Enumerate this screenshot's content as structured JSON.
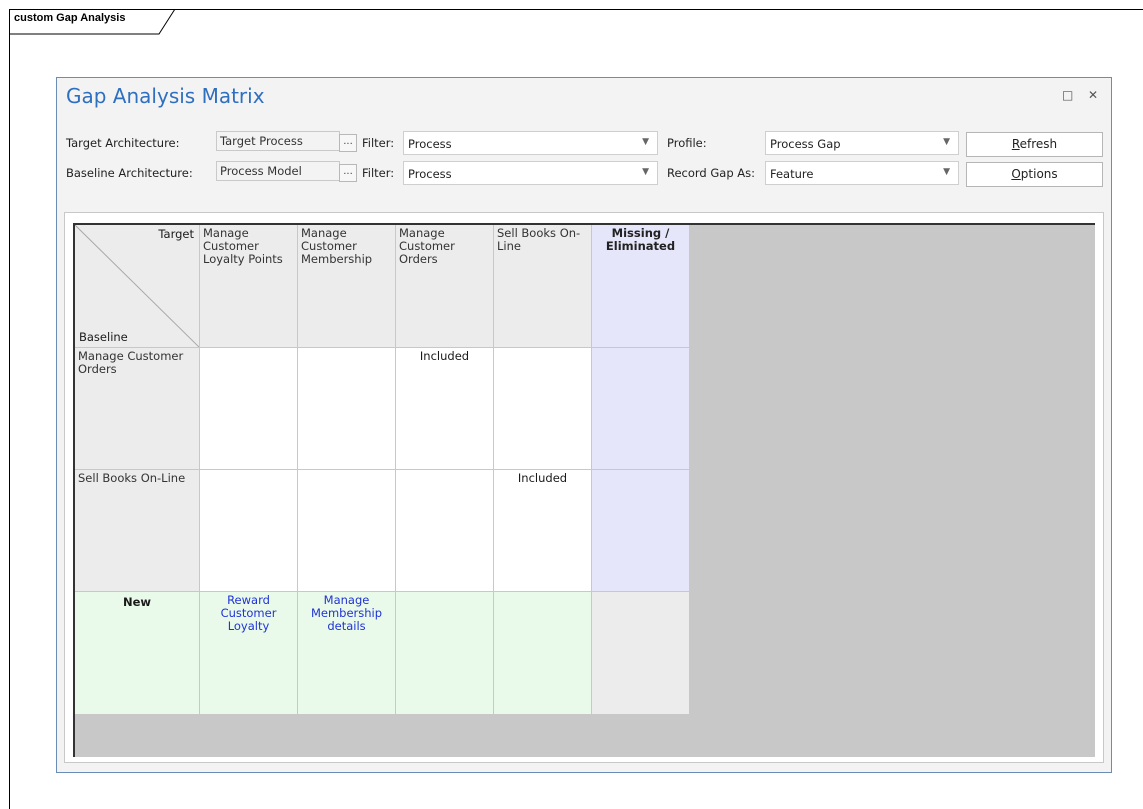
{
  "frame": {
    "label": "custom Gap Analysis"
  },
  "window": {
    "title": "Gap Analysis Matrix",
    "restore_icon": "restore-icon",
    "close_icon": "close-icon"
  },
  "toolbar": {
    "target_label": "Target Architecture:",
    "target_value": "Target Process",
    "baseline_label": "Baseline Architecture:",
    "baseline_value": "Process Model",
    "browse_label": "...",
    "filter_label": "Filter:",
    "target_filter_value": "Process",
    "baseline_filter_value": "Process",
    "profile_label": "Profile:",
    "profile_value": "Process Gap",
    "record_gap_label": "Record Gap As:",
    "record_gap_value": "Feature",
    "refresh_button": {
      "mnemonic": "R",
      "rest": "efresh"
    },
    "options_button": {
      "mnemonic": "O",
      "rest": "ptions"
    }
  },
  "matrix": {
    "corner": {
      "target": "Target",
      "baseline": "Baseline"
    },
    "columns": [
      "Manage Customer Loyalty Points",
      "Manage Customer Membership",
      "Manage Customer Orders",
      "Sell Books On-Line"
    ],
    "missing_column": "Missing / Eliminated",
    "rows": [
      {
        "label": "Manage Customer Orders",
        "cells": [
          "",
          "",
          "Included",
          ""
        ]
      },
      {
        "label": "Sell Books On-Line",
        "cells": [
          "",
          "",
          "",
          "Included"
        ]
      }
    ],
    "new_row": {
      "label": "New",
      "cells": [
        "Reward Customer Loyalty",
        "Manage Membership details",
        "",
        ""
      ]
    }
  }
}
